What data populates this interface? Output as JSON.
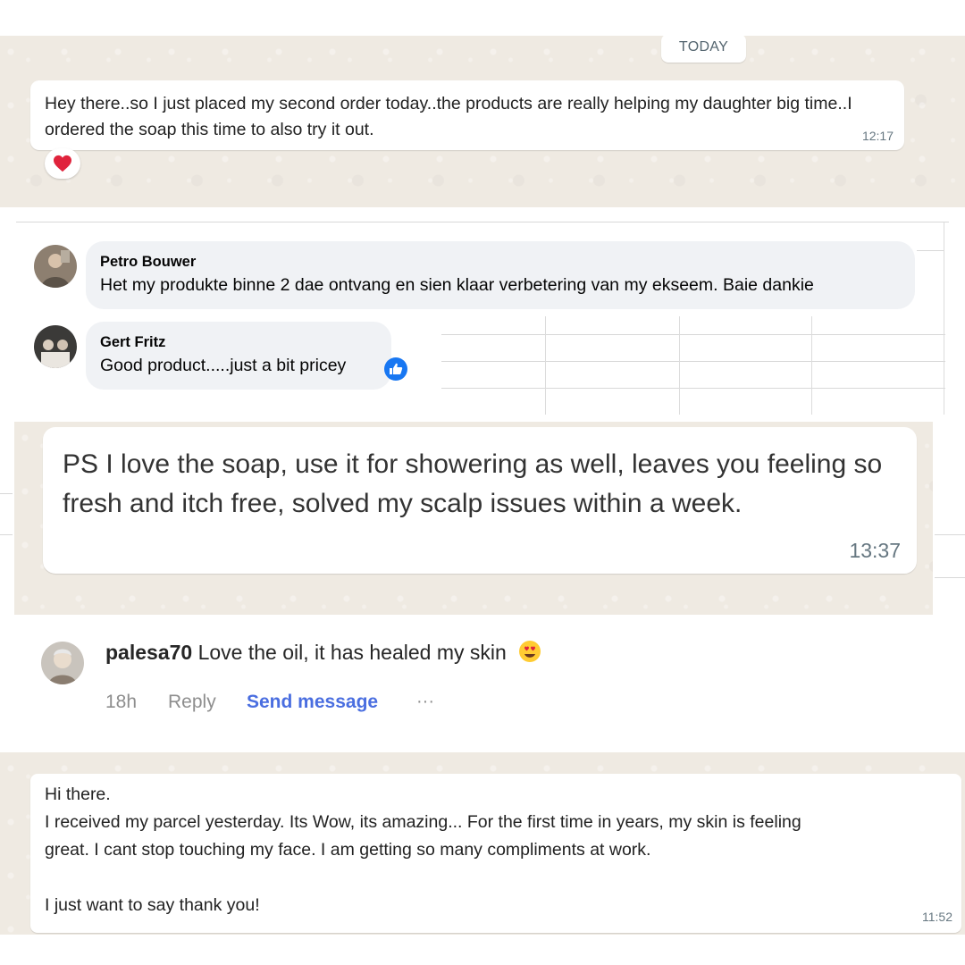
{
  "whatsapp_1": {
    "day_label": "TODAY",
    "message": "Hey there..so I just placed my second order today..the products are really helping my daughter big time..I ordered the soap this time to also try it out.",
    "time": "12:17",
    "reaction_icon": "heart-icon",
    "reaction_color": "#e0233c"
  },
  "facebook": {
    "comments": [
      {
        "name": "Petro Bouwer",
        "text": "Het my produkte binne 2 dae ontvang en sien klaar verbetering van my ekseem. Baie dankie"
      },
      {
        "name": "Gert Fritz",
        "text": "Good product.....just a bit pricey"
      }
    ],
    "like_icon": "thumbs-up-icon",
    "like_color": "#1877f2"
  },
  "whatsapp_2": {
    "message": "PS I love the soap, use it for showering as well, leaves you feeling so fresh and itch free, solved my scalp issues within a week.",
    "time": "13:37"
  },
  "instagram": {
    "username": "palesa70",
    "comment": "Love the oil, it has healed my skin",
    "emoji_icon": "heart-eyes-emoji-icon",
    "age": "18h",
    "reply_label": "Reply",
    "send_message_label": "Send message",
    "more_label": "···",
    "link_color": "#4a6ee0"
  },
  "whatsapp_3": {
    "lines": [
      "Hi there.",
      "I received my parcel yesterday. Its Wow, its amazing... For the first time in years, my skin is feeling",
      "great. I cant stop touching my face. I am getting so many compliments at work.",
      "I just want to say thank you!"
    ],
    "time": "11:52"
  }
}
